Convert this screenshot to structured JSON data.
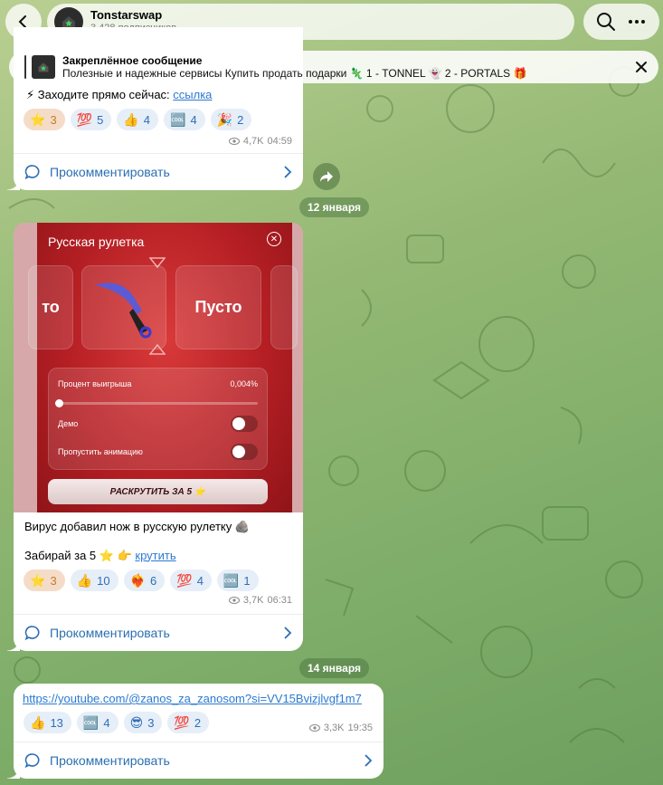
{
  "header": {
    "channel_title": "Tonstarswap",
    "subscribers": "3 428 подписчиков"
  },
  "pinned": {
    "title": "Закреплённое сообщение",
    "text": "Полезные и надежные сервисы   Купить продать подарки 🦎 1 - TONNEL 👻 2 - PORTALS 🎁"
  },
  "posts": [
    {
      "partial_text_prefix": "⚡ Заходите прямо сейчас: ",
      "link_text": "ссылка",
      "reactions": [
        {
          "emoji": "⭐",
          "count": "3",
          "mine": true
        },
        {
          "emoji": "💯",
          "count": "5"
        },
        {
          "emoji": "👍",
          "count": "4"
        },
        {
          "emoji": "🆒",
          "count": "4"
        },
        {
          "emoji": "🎉",
          "count": "2"
        }
      ],
      "views": "4,7K",
      "time": "04:59",
      "comment_label": "Прокомментировать"
    },
    {
      "line1": "Вирус добавил нож в русскую рулетку 🪨",
      "line2_prefix": "Забирай за 5 ⭐ 👉 ",
      "link_text": "крутить",
      "reactions": [
        {
          "emoji": "⭐",
          "count": "3",
          "mine": true
        },
        {
          "emoji": "👍",
          "count": "10"
        },
        {
          "emoji": "❤️‍🔥",
          "count": "6"
        },
        {
          "emoji": "💯",
          "count": "4"
        },
        {
          "emoji": "🆒",
          "count": "1"
        }
      ],
      "views": "3,7K",
      "time": "06:31",
      "comment_label": "Прокомментировать"
    },
    {
      "link_text": "https://youtube.com/@zanos_za_zanosom?si=VV15Bvizjlvgf1m7",
      "reactions": [
        {
          "emoji": "👍",
          "count": "13"
        },
        {
          "emoji": "🆒",
          "count": "4"
        },
        {
          "emoji": "😎",
          "count": "3"
        },
        {
          "emoji": "💯",
          "count": "2"
        }
      ],
      "views": "3,3K",
      "time": "19:35",
      "comment_label": "Прокомментировать"
    }
  ],
  "dates": {
    "d1": "12 января",
    "d2": "14 января"
  },
  "game": {
    "title": "Русская рулетка",
    "slot_left": "то",
    "slot_right": "Пусто",
    "win_label": "Процент выигрыша",
    "win_value": "0,004%",
    "demo_label": "Демо",
    "skip_label": "Пропустить анимацию",
    "spin_label": "РАСКРУТИТЬ ЗА 5 ⭐"
  },
  "colors": {
    "accent": "#2b6fb2",
    "game_red": "#b51f24"
  }
}
